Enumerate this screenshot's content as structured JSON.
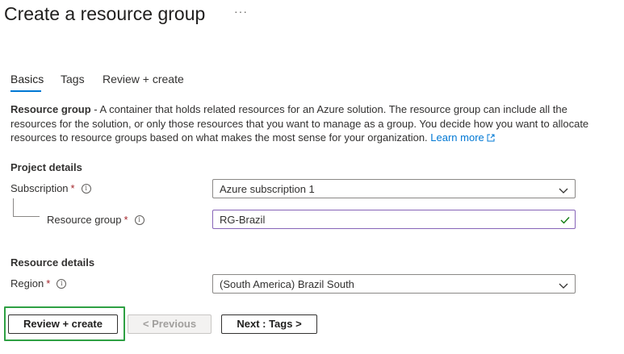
{
  "page": {
    "title": "Create a resource group",
    "more_label": "···"
  },
  "tabs": [
    {
      "label": "Basics",
      "active": true
    },
    {
      "label": "Tags",
      "active": false
    },
    {
      "label": "Review + create",
      "active": false
    }
  ],
  "description": {
    "term": "Resource group",
    "text": " - A container that holds related resources for an Azure solution. The resource group can include all the resources for the solution, or only those resources that you want to manage as a group. You decide how you want to allocate resources to resource groups based on what makes the most sense for your organization. ",
    "link_label": "Learn more"
  },
  "project_details": {
    "heading": "Project details",
    "subscription": {
      "label": "Subscription",
      "required_mark": "*",
      "value": "Azure subscription 1"
    },
    "resource_group": {
      "label": "Resource group",
      "required_mark": "*",
      "value": "RG-Brazil"
    }
  },
  "resource_details": {
    "heading": "Resource details",
    "region": {
      "label": "Region",
      "required_mark": "*",
      "value": "(South America) Brazil South"
    }
  },
  "footer": {
    "review_create_label": "Review + create",
    "previous_label": "< Previous",
    "next_label": "Next : Tags >"
  },
  "colors": {
    "accent": "#0078d4",
    "required": "#a4262c",
    "highlight": "#2ea043",
    "validation_border": "#8764b8",
    "check": "#107c10"
  },
  "icons": {
    "info": "info-icon",
    "chevron": "chevron-down-icon",
    "check": "checkmark-icon",
    "external": "external-link-icon"
  }
}
